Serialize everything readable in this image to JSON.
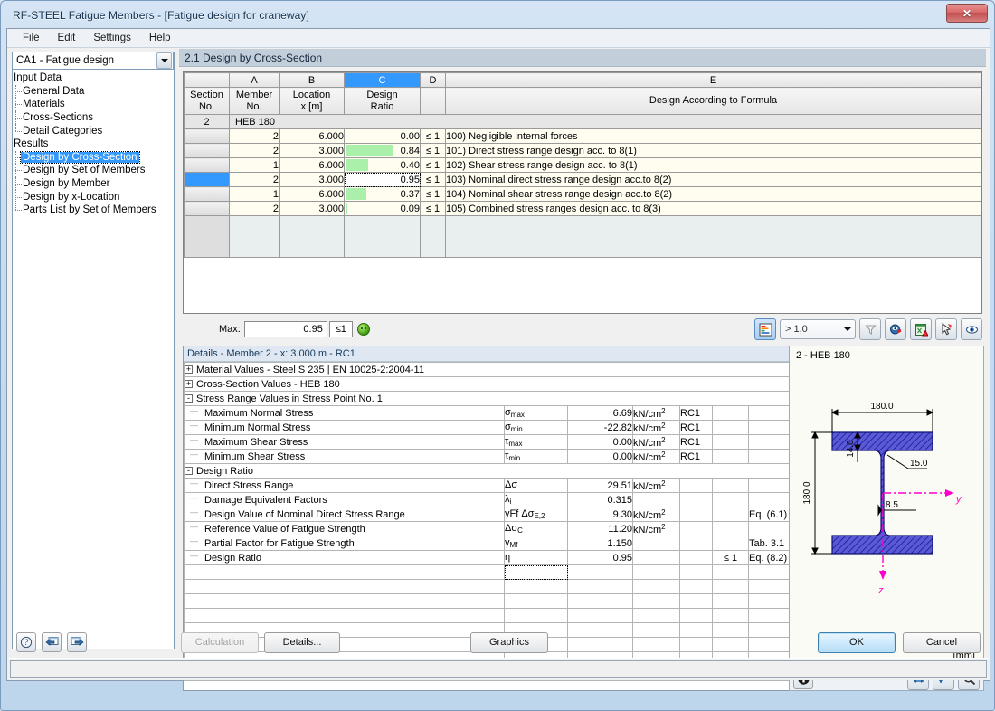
{
  "window": {
    "title": "RF-STEEL Fatigue Members - [Fatigue design for craneway]",
    "close_label": "✕"
  },
  "menubar": {
    "items": [
      {
        "label": "File"
      },
      {
        "label": "Edit"
      },
      {
        "label": "Settings"
      },
      {
        "label": "Help"
      }
    ]
  },
  "sidebar": {
    "case_selector": {
      "value": "CA1 - Fatigue design"
    },
    "tree": [
      {
        "label": "Input Data",
        "level": 0,
        "selected": false
      },
      {
        "label": "General Data",
        "level": 1,
        "selected": false
      },
      {
        "label": "Materials",
        "level": 1,
        "selected": false
      },
      {
        "label": "Cross-Sections",
        "level": 1,
        "selected": false
      },
      {
        "label": "Detail Categories",
        "level": 1,
        "selected": false,
        "last": true
      },
      {
        "label": "Results",
        "level": 0,
        "selected": false
      },
      {
        "label": "Design by Cross-Section",
        "level": 1,
        "selected": true
      },
      {
        "label": "Design by Set of Members",
        "level": 1,
        "selected": false
      },
      {
        "label": "Design by Member",
        "level": 1,
        "selected": false
      },
      {
        "label": "Design by x-Location",
        "level": 1,
        "selected": false
      },
      {
        "label": "Parts List by Set of Members",
        "level": 1,
        "selected": false,
        "last": true
      }
    ]
  },
  "content": {
    "section_title": "2.1 Design by Cross-Section"
  },
  "grid": {
    "column_letters": [
      "",
      "A",
      "B",
      "C",
      "D",
      "E"
    ],
    "headers": [
      "Section\nNo.",
      "Member\nNo.",
      "Location\nx [m]",
      "Design\nRatio",
      "",
      "Design According to Formula"
    ],
    "header_lines": {
      "section_1": "Section",
      "section_2": "No.",
      "member_1": "Member",
      "member_2": "No.",
      "location_1": "Location",
      "location_2": "x [m]",
      "ratio_1": "Design",
      "ratio_2": "Ratio",
      "formula": "Design According to Formula"
    },
    "section_row": {
      "no": "2",
      "name": "HEB 180"
    },
    "rows": [
      {
        "member": "2",
        "location": "6.000",
        "ratio": "0.00",
        "ratio_pct": 1,
        "cmp": "≤ 1",
        "formula": "100) Negligible internal forces",
        "selected": false
      },
      {
        "member": "2",
        "location": "3.000",
        "ratio": "0.84",
        "ratio_pct": 84,
        "cmp": "≤ 1",
        "formula": "101) Direct stress range design acc. to 8(1)",
        "selected": false
      },
      {
        "member": "1",
        "location": "6.000",
        "ratio": "0.40",
        "ratio_pct": 40,
        "cmp": "≤ 1",
        "formula": "102) Shear stress range design acc. to 8(1)",
        "selected": false
      },
      {
        "member": "2",
        "location": "3.000",
        "ratio": "0.95",
        "ratio_pct": 0,
        "cmp": "≤ 1",
        "formula": "103) Nominal direct stress range design acc.to 8(2)",
        "selected": true
      },
      {
        "member": "1",
        "location": "6.000",
        "ratio": "0.37",
        "ratio_pct": 37,
        "cmp": "≤ 1",
        "formula": "104) Nominal shear stress range design acc.to 8(2)",
        "selected": false
      },
      {
        "member": "2",
        "location": "3.000",
        "ratio": "0.09",
        "ratio_pct": 4,
        "cmp": "≤ 1",
        "formula": "105) Combined stress ranges design acc. to 8(3)",
        "selected": false
      }
    ],
    "max": {
      "label": "Max:",
      "value": "0.95",
      "cmp": "≤1"
    },
    "filter": {
      "value": "> 1,0"
    }
  },
  "details": {
    "title": "Details - Member 2 - x: 3.000 m - RC1",
    "groups": [
      {
        "kind": "group",
        "expander": "+",
        "label": "Material Values - Steel S 235 | EN 10025-2:2004-11"
      },
      {
        "kind": "group",
        "expander": "+",
        "label": "Cross-Section Values  -  HEB 180"
      },
      {
        "kind": "group",
        "expander": "-",
        "label": "Stress Range Values in Stress Point No. 1"
      },
      {
        "kind": "item",
        "label": "Maximum Normal Stress",
        "sym": "σ",
        "sub": "max",
        "value": "6.69",
        "unit": "kN/cm",
        "unit_sup": "2",
        "lc": "RC1",
        "cmp": "",
        "note": ""
      },
      {
        "kind": "item",
        "label": "Minimum Normal Stress",
        "sym": "σ",
        "sub": "min",
        "value": "-22.82",
        "unit": "kN/cm",
        "unit_sup": "2",
        "lc": "RC1",
        "cmp": "",
        "note": ""
      },
      {
        "kind": "item",
        "label": "Maximum Shear Stress",
        "sym": "τ",
        "sub": "max",
        "value": "0.00",
        "unit": "kN/cm",
        "unit_sup": "2",
        "lc": "RC1",
        "cmp": "",
        "note": ""
      },
      {
        "kind": "item",
        "label": "Minimum Shear Stress",
        "sym": "τ",
        "sub": "min",
        "value": "0.00",
        "unit": "kN/cm",
        "unit_sup": "2",
        "lc": "RC1",
        "cmp": "",
        "note": ""
      },
      {
        "kind": "group",
        "expander": "-",
        "label": "Design Ratio"
      },
      {
        "kind": "item",
        "label": "Direct Stress Range",
        "sym": "Δσ",
        "sub": "",
        "value": "29.51",
        "unit": "kN/cm",
        "unit_sup": "2",
        "lc": "",
        "cmp": "",
        "note": ""
      },
      {
        "kind": "item",
        "label": "Damage Equivalent Factors",
        "sym": "λ",
        "sub": "i",
        "value": "0.315",
        "unit": "",
        "unit_sup": "",
        "lc": "",
        "cmp": "",
        "note": ""
      },
      {
        "kind": "item",
        "label": "Design Value of Nominal Direct Stress Range",
        "sym": "γFf Δσ",
        "sub": "E,2",
        "value": "9.30",
        "unit": "kN/cm",
        "unit_sup": "2",
        "lc": "",
        "cmp": "",
        "note": "Eq. (6.1)"
      },
      {
        "kind": "item",
        "label": "Reference Value of Fatigue Strength",
        "sym": "Δσ",
        "sub": "C",
        "value": "11.20",
        "unit": "kN/cm",
        "unit_sup": "2",
        "lc": "",
        "cmp": "",
        "note": ""
      },
      {
        "kind": "item",
        "label": "Partial Factor for Fatigue Strength",
        "sym": "γ",
        "sub": "Mf",
        "value": "1.150",
        "unit": "",
        "unit_sup": "",
        "lc": "",
        "cmp": "",
        "note": "Tab. 3.1"
      },
      {
        "kind": "item",
        "label": "Design Ratio",
        "sym": "η",
        "sub": "",
        "value": "0.95",
        "unit": "",
        "unit_sup": "",
        "lc": "",
        "cmp": "≤ 1",
        "note": "Eq. (8.2)"
      }
    ],
    "blank_row_count": 9
  },
  "cross_section": {
    "title": "2 - HEB 180",
    "unit": "[mm]",
    "dimensions": {
      "width": "180.0",
      "height": "180.0",
      "flange_thickness": "14.0",
      "root_radius": "15.0",
      "web_thickness": "8.5"
    },
    "axes": {
      "y": "y",
      "z": "z"
    }
  },
  "footer": {
    "calculation": "Calculation",
    "details": "Details...",
    "graphics": "Graphics",
    "ok": "OK",
    "cancel": "Cancel"
  },
  "colors": {
    "accent": "#3399ff",
    "ratio_bar": "#aaf0aa",
    "section_fill": "#3a3ad0",
    "axis": "#ff00cc",
    "titlebar_text": "#16324f"
  }
}
